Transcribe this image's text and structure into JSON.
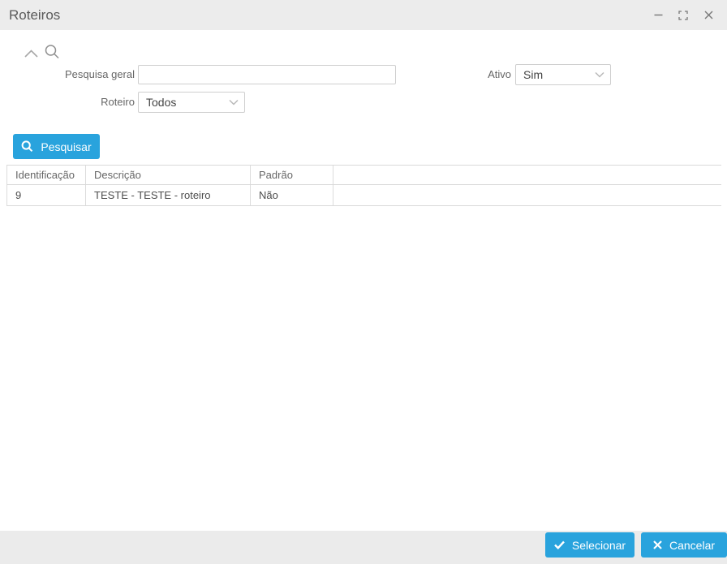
{
  "window": {
    "title": "Roteiros"
  },
  "filters": {
    "general_search": {
      "label": "Pesquisa geral",
      "value": "",
      "placeholder": ""
    },
    "ativo": {
      "label": "Ativo",
      "value": "Sim"
    },
    "roteiro": {
      "label": "Roteiro",
      "value": "Todos"
    }
  },
  "actions": {
    "search_label": "Pesquisar",
    "select_label": "Selecionar",
    "cancel_label": "Cancelar"
  },
  "table": {
    "columns": [
      "Identificação",
      "Descrição",
      "Padrão",
      ""
    ],
    "rows": [
      [
        "9",
        "TESTE - TESTE - roteiro",
        "Não",
        ""
      ]
    ]
  },
  "icons": {
    "titlebar": [
      "minimize",
      "maximize",
      "close"
    ],
    "panel": [
      "chevron-up",
      "magnifier"
    ],
    "search_button": "magnifier",
    "select_button": "check",
    "cancel_button": "x",
    "dropdown": "chevron-down"
  },
  "colors": {
    "accent": "#29a3dd",
    "titlebar_bg": "#ececec",
    "footer_bg": "#ebebeb",
    "grid_border": "#d9d9d9",
    "label_text": "#666666"
  }
}
